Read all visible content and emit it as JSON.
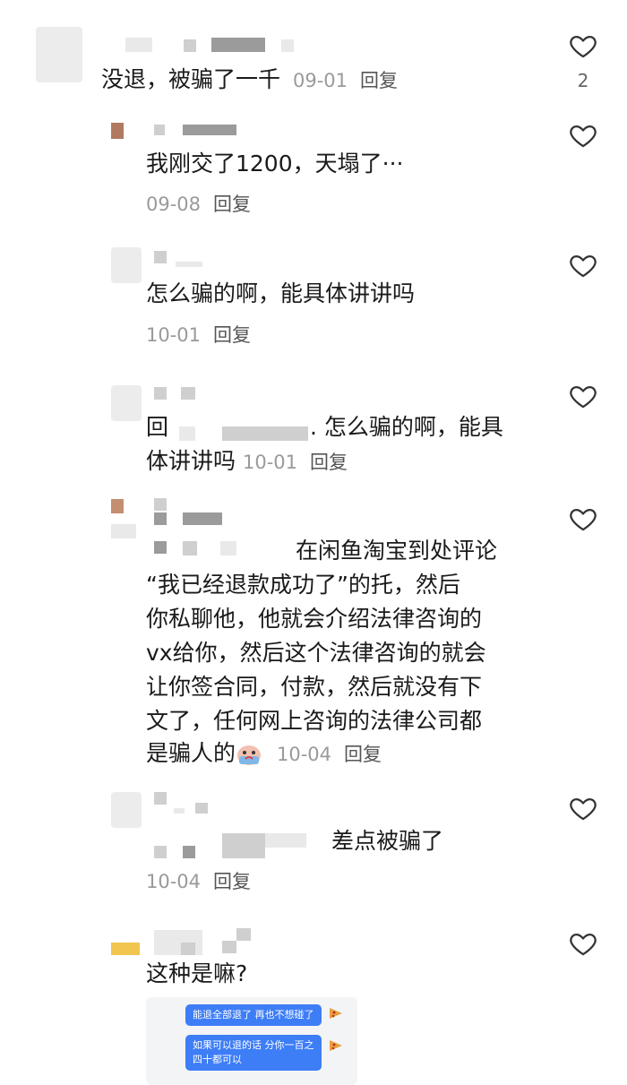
{
  "comments": [
    {
      "text": "没退，被骗了一千",
      "date": "09-01",
      "reply": "回复",
      "likes": "2"
    },
    {
      "text": "我刚交了1200，天塌了···",
      "date": "09-08",
      "reply": "回复"
    },
    {
      "text": "怎么骗的啊，能具体讲讲吗",
      "date": "10-01",
      "reply": "回复"
    },
    {
      "prefix": "回",
      "text_line1": ". 怎么骗的啊，能具",
      "text_line2": "体讲讲吗",
      "date": "10-01",
      "reply": "回复"
    },
    {
      "line1": "在闲鱼淘宝到处评论",
      "line2": "“我已经退款成功了”的托，然后",
      "line3": "你私聊他，他就会介绍法律咨询的",
      "line4": "vx给你，然后这个法律咨询的就会",
      "line5": "让你签合同，付款，然后就没有下",
      "line6": "文了，任何网上咨询的法律公司都",
      "line7": "是骗人的",
      "date": "10-04",
      "reply": "回复"
    },
    {
      "text": "差点被骗了",
      "date": "10-04",
      "reply": "回复"
    },
    {
      "text": "这种是嘛?"
    }
  ],
  "chat_image": {
    "bubble1": "能退全部退了 再也不想碰了",
    "bubble2_line1": "如果可以退的话 分你一百之",
    "bubble2_line2": "四十都可以"
  },
  "icons": {
    "like": "heart-outline-icon",
    "emoji": "crying-emoji-icon",
    "avatar_food": "pizza-icon"
  }
}
